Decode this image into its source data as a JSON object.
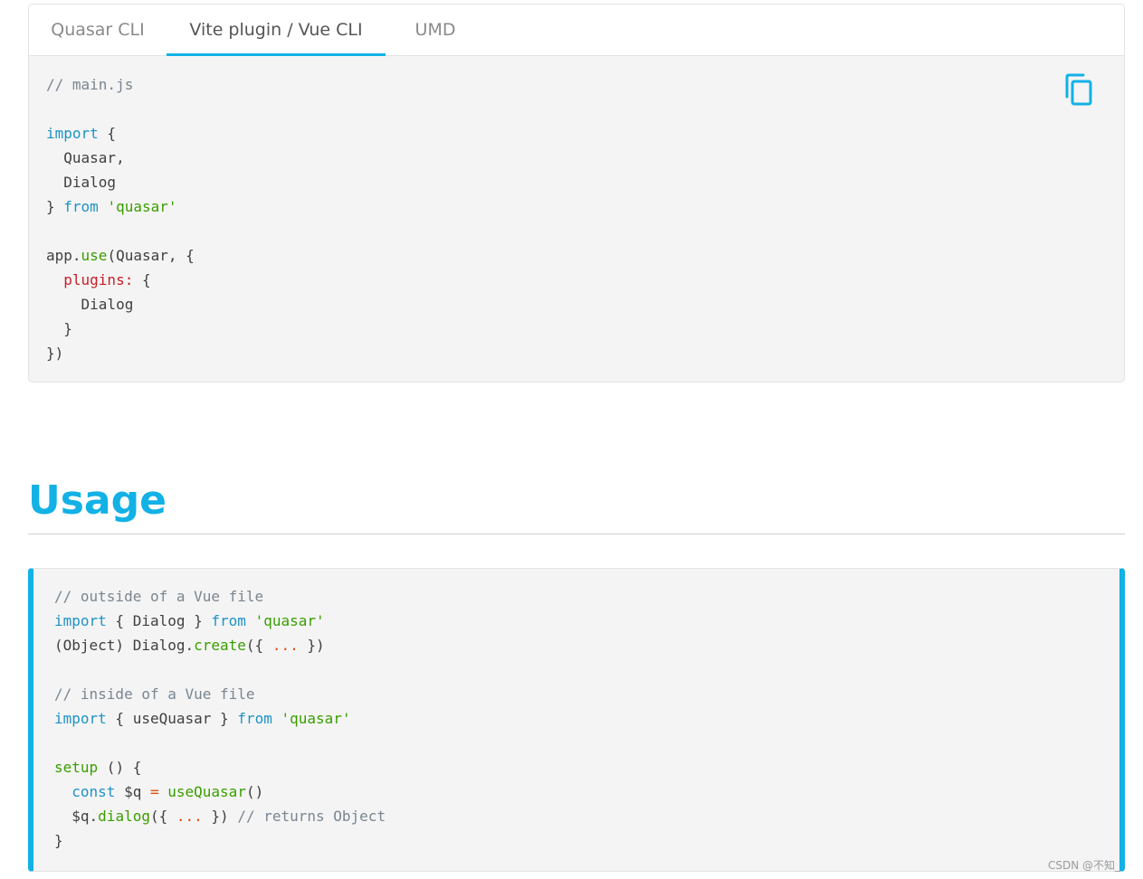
{
  "tabs": [
    {
      "label": "Quasar CLI",
      "active": false
    },
    {
      "label": "Vite plugin / Vue CLI",
      "active": true
    },
    {
      "label": "UMD",
      "active": false
    }
  ],
  "accent_color": "#12b1e6",
  "copy_icon": "copy-icon",
  "install_code": [
    [
      [
        "comment",
        "// main.js"
      ]
    ],
    [],
    [
      [
        "keyword",
        "import"
      ],
      [
        "plain",
        " {"
      ]
    ],
    [
      [
        "plain",
        "  Quasar,"
      ]
    ],
    [
      [
        "plain",
        "  Dialog"
      ]
    ],
    [
      [
        "plain",
        "} "
      ],
      [
        "keyword",
        "from"
      ],
      [
        "plain",
        " "
      ],
      [
        "string",
        "'quasar'"
      ]
    ],
    [],
    [
      [
        "plain",
        "app."
      ],
      [
        "func",
        "use"
      ],
      [
        "plain",
        "(Quasar, {"
      ]
    ],
    [
      [
        "plain",
        "  "
      ],
      [
        "prop",
        "plugins:"
      ],
      [
        "plain",
        " {"
      ]
    ],
    [
      [
        "plain",
        "    Dialog"
      ]
    ],
    [
      [
        "plain",
        "  }"
      ]
    ],
    [
      [
        "plain",
        "})"
      ]
    ]
  ],
  "usage_heading": "Usage",
  "usage_code": [
    [
      [
        "comment",
        "// outside of a Vue file"
      ]
    ],
    [
      [
        "keyword",
        "import"
      ],
      [
        "plain",
        " { Dialog } "
      ],
      [
        "keyword",
        "from"
      ],
      [
        "plain",
        " "
      ],
      [
        "string",
        "'quasar'"
      ]
    ],
    [
      [
        "plain",
        "(Object) Dialog."
      ],
      [
        "func",
        "create"
      ],
      [
        "plain",
        "({ "
      ],
      [
        "op",
        "..."
      ],
      [
        "plain",
        " })"
      ]
    ],
    [],
    [
      [
        "comment",
        "// inside of a Vue file"
      ]
    ],
    [
      [
        "keyword",
        "import"
      ],
      [
        "plain",
        " { useQuasar } "
      ],
      [
        "keyword",
        "from"
      ],
      [
        "plain",
        " "
      ],
      [
        "string",
        "'quasar'"
      ]
    ],
    [],
    [
      [
        "func",
        "setup"
      ],
      [
        "plain",
        " () {"
      ]
    ],
    [
      [
        "plain",
        "  "
      ],
      [
        "keyword",
        "const"
      ],
      [
        "plain",
        " $q "
      ],
      [
        "op",
        "="
      ],
      [
        "plain",
        " "
      ],
      [
        "func",
        "useQuasar"
      ],
      [
        "plain",
        "()"
      ]
    ],
    [
      [
        "plain",
        "  $q."
      ],
      [
        "func",
        "dialog"
      ],
      [
        "plain",
        "({ "
      ],
      [
        "op",
        "..."
      ],
      [
        "plain",
        " }) "
      ],
      [
        "comment",
        "// returns Object"
      ]
    ],
    [
      [
        "plain",
        "}"
      ]
    ]
  ],
  "watermark": "CSDN @不知_"
}
